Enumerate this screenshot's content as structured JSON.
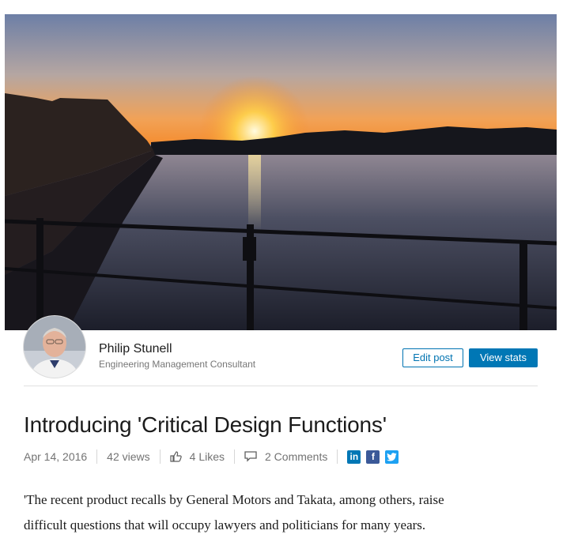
{
  "author": {
    "name": "Philip Stunell",
    "title": "Engineering Management Consultant"
  },
  "actions": {
    "edit_label": "Edit post",
    "stats_label": "View stats"
  },
  "article": {
    "title": "Introducing 'Critical Design Functions'",
    "date": "Apr 14, 2016",
    "views": "42 views",
    "likes": "4 Likes",
    "comments": "2 Comments",
    "body_line1": "'The recent product recalls by General Motors and Takata, among others, raise",
    "body_line2": "difficult questions that will occupy lawyers and politicians for many years."
  },
  "share": {
    "linkedin_glyph": "in",
    "facebook_glyph": "f"
  },
  "icons": [
    "thumbs-up-icon",
    "comment-icon",
    "linkedin-icon",
    "facebook-icon",
    "twitter-icon"
  ],
  "colors": {
    "accent": "#0077b5",
    "facebook": "#3b5998",
    "twitter": "#1da1f2"
  }
}
